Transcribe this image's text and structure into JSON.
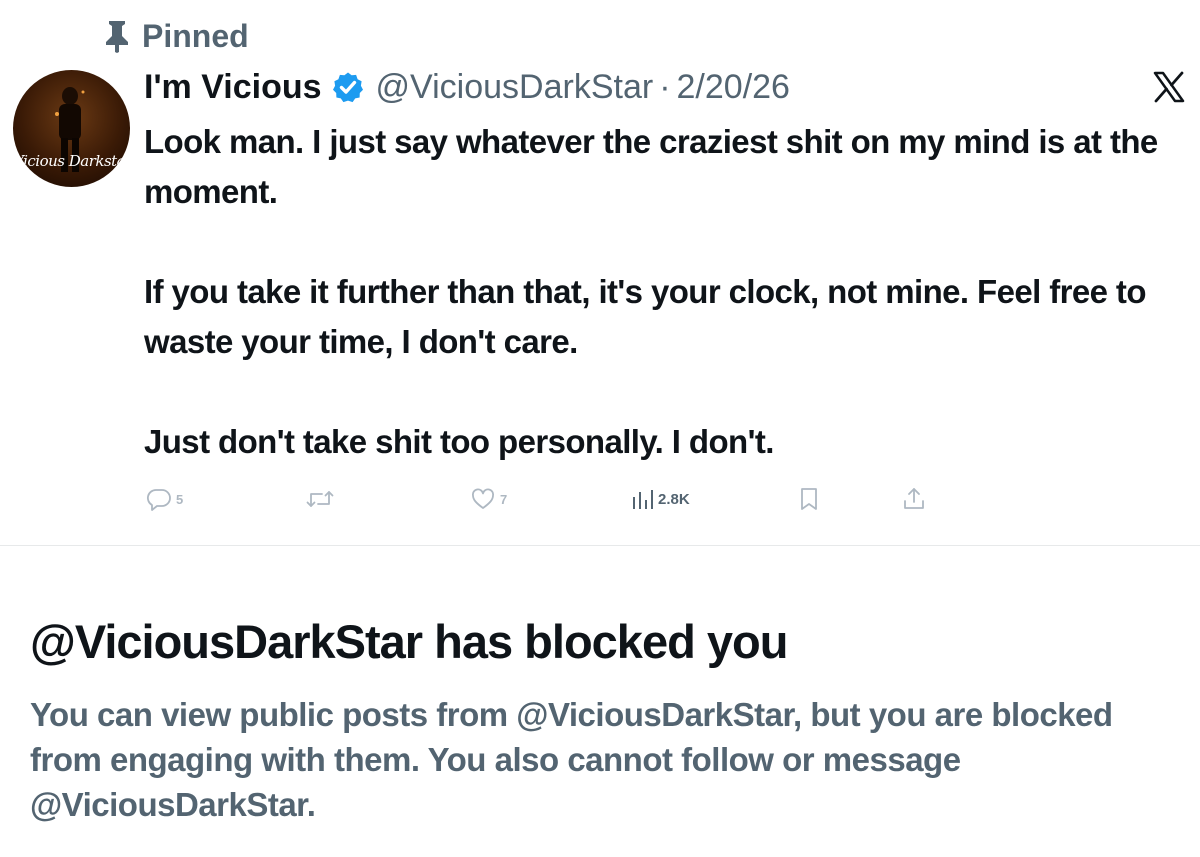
{
  "pinned": {
    "label": "Pinned",
    "icon": "pin-icon"
  },
  "avatar": {
    "icon": "avatar-image",
    "signature_text": "Vicious Darkstar"
  },
  "author": {
    "display_name": "I'm Vicious",
    "verified": true,
    "handle": "@ViciousDarkStar",
    "separator": "·",
    "date": "2/20/26"
  },
  "x_logo": "x-logo-icon",
  "tweet": {
    "paragraphs": [
      "Look man. I just say whatever the craziest shit on my mind is at the moment.",
      "If you take it further than that, it's your clock, not mine. Feel free to waste your time, I don't care.",
      "Just don't take shit too personally. I don't."
    ]
  },
  "actions": {
    "replies": "5",
    "reposts": "",
    "likes": "7",
    "views": "2.8K",
    "icons": [
      "reply-icon",
      "repost-icon",
      "like-icon",
      "views-icon",
      "bookmark-icon",
      "share-icon"
    ]
  },
  "blocked": {
    "title": "@ViciousDarkStar has blocked you",
    "description": "You can view public posts from @ViciousDarkStar, but you are blocked from engaging with them. You also cannot follow or message @ViciousDarkStar."
  },
  "colors": {
    "text_primary": "#0f1419",
    "text_secondary": "#536471",
    "verified_blue": "#1d9bf0",
    "muted_action": "#aeb8c2",
    "divider": "#e7e9ea"
  }
}
